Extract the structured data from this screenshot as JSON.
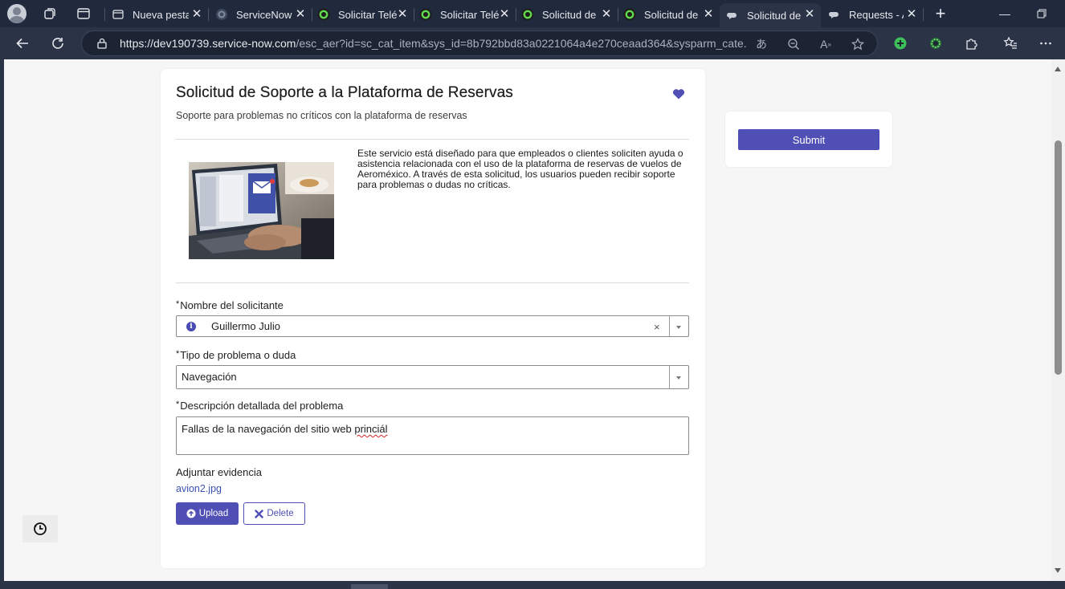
{
  "browser": {
    "tabs": [
      {
        "title": "Nueva pestaña",
        "active": false,
        "icon": "newtab-icon"
      },
      {
        "title": "ServiceNow",
        "active": false,
        "icon": "servicenow-icon"
      },
      {
        "title": "Solicitar Telé",
        "active": false,
        "icon": "servicenow-green-icon"
      },
      {
        "title": "Solicitar Telé",
        "active": false,
        "icon": "servicenow-green-icon"
      },
      {
        "title": "Solicitud de",
        "active": false,
        "icon": "servicenow-green-icon"
      },
      {
        "title": "Solicitud de",
        "active": false,
        "icon": "servicenow-green-icon"
      },
      {
        "title": "Solicitud de",
        "active": true,
        "icon": "servicenow-chat-icon"
      },
      {
        "title": "Requests - A",
        "active": false,
        "icon": "servicenow-chat-icon"
      }
    ],
    "url_host": "https://dev190739.service-now.com",
    "url_path": "/esc_aer?id=sc_cat_item&sys_id=8b792bbd83a0221064a4e270ceaad364&sysparm_cate..."
  },
  "form": {
    "title": "Solicitud de Soporte a la Plataforma de Reservas",
    "subtitle": "Soporte para problemas no críticos con la plataforma de reservas",
    "description": "Este servicio está diseñado para que empleados o clientes soliciten ayuda o asistencia relacionada con el uso de la plataforma de reservas de vuelos de Aeroméxico. A través de esta solicitud, los usuarios pueden recibir soporte para problemas o dudas no críticas.",
    "fields": {
      "requester": {
        "required_mark": "*",
        "label": "Nombre del solicitante",
        "value": "Guillermo Julio"
      },
      "issue_type": {
        "required_mark": "*",
        "label": "Tipo de problema o duda",
        "value": "Navegación"
      },
      "details": {
        "required_mark": "*",
        "label": "Descripción detallada del problema",
        "value_prefix": "Fallas de la navegación del sitio web ",
        "value_misspelled": "princiál"
      }
    },
    "attachment": {
      "label": "Adjuntar evidencia",
      "filename": "avion2.jpg",
      "upload_label": "Upload",
      "delete_label": "Delete"
    }
  },
  "sidebar": {
    "submit_label": "Submit"
  },
  "colors": {
    "accent": "#4f4fb5",
    "link": "#3c50b4",
    "browser_chrome": "#202a3c"
  }
}
